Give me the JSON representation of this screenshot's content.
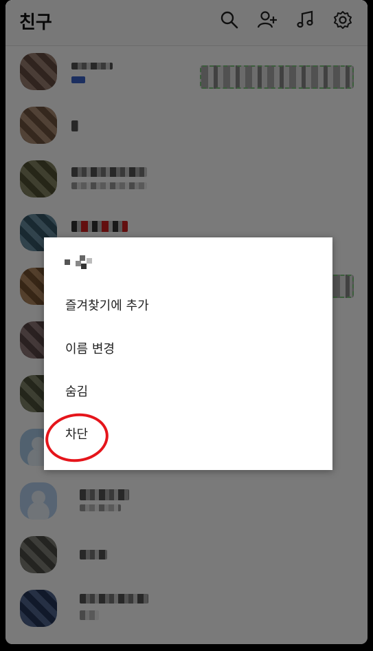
{
  "header": {
    "title": "친구",
    "icons": [
      "search-icon",
      "add-friend-icon",
      "music-icon",
      "settings-icon"
    ]
  },
  "friends_count_visible": 11,
  "menu": {
    "items": [
      {
        "label": "즐겨찾기에 추가"
      },
      {
        "label": "이름 변경"
      },
      {
        "label": "숨김"
      },
      {
        "label": "차단"
      }
    ],
    "highlighted_item": "차단"
  },
  "colors": {
    "overlay": "#000000",
    "highlight_circle": "#e5151b",
    "status_border": "#7cc47c"
  }
}
